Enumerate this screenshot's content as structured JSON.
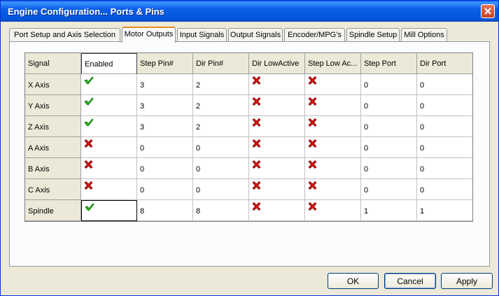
{
  "window": {
    "title": "Engine Configuration... Ports & Pins"
  },
  "tabs": [
    {
      "label": "Port Setup and Axis Selection",
      "active": false
    },
    {
      "label": "Motor Outputs",
      "active": true
    },
    {
      "label": "Input Signals",
      "active": false
    },
    {
      "label": "Output Signals",
      "active": false
    },
    {
      "label": "Encoder/MPG's",
      "active": false
    },
    {
      "label": "Spindle Setup",
      "active": false
    },
    {
      "label": "Mill Options",
      "active": false
    }
  ],
  "table": {
    "columns": [
      "Signal",
      "Enabled",
      "Step Pin#",
      "Dir Pin#",
      "Dir LowActive",
      "Step Low Ac...",
      "Step Port",
      "Dir Port"
    ],
    "rows": [
      {
        "signal": "X Axis",
        "enabled": "check-icon",
        "step_pin": "3",
        "dir_pin": "2",
        "dir_low_active": "cross-icon",
        "step_low_active": "cross-icon",
        "step_port": "0",
        "dir_port": "0"
      },
      {
        "signal": "Y Axis",
        "enabled": "check-icon",
        "step_pin": "3",
        "dir_pin": "2",
        "dir_low_active": "cross-icon",
        "step_low_active": "cross-icon",
        "step_port": "0",
        "dir_port": "0"
      },
      {
        "signal": "Z Axis",
        "enabled": "check-icon",
        "step_pin": "3",
        "dir_pin": "2",
        "dir_low_active": "cross-icon",
        "step_low_active": "cross-icon",
        "step_port": "0",
        "dir_port": "0"
      },
      {
        "signal": "A Axis",
        "enabled": "cross-icon",
        "step_pin": "0",
        "dir_pin": "0",
        "dir_low_active": "cross-icon",
        "step_low_active": "cross-icon",
        "step_port": "0",
        "dir_port": "0"
      },
      {
        "signal": "B Axis",
        "enabled": "cross-icon",
        "step_pin": "0",
        "dir_pin": "0",
        "dir_low_active": "cross-icon",
        "step_low_active": "cross-icon",
        "step_port": "0",
        "dir_port": "0"
      },
      {
        "signal": "C Axis",
        "enabled": "cross-icon",
        "step_pin": "0",
        "dir_pin": "0",
        "dir_low_active": "cross-icon",
        "step_low_active": "cross-icon",
        "step_port": "0",
        "dir_port": "0"
      },
      {
        "signal": "Spindle",
        "enabled": "check-icon",
        "step_pin": "8",
        "dir_pin": "8",
        "dir_low_active": "cross-icon",
        "step_low_active": "cross-icon",
        "step_port": "1",
        "dir_port": "1"
      }
    ]
  },
  "buttons": {
    "ok": "OK",
    "cancel": "Cancel",
    "apply": "Apply"
  },
  "colors": {
    "check": "#22c40e",
    "cross": "#d81414",
    "titlebar": "#0355d9",
    "tab_highlight": "#e68b2c"
  }
}
